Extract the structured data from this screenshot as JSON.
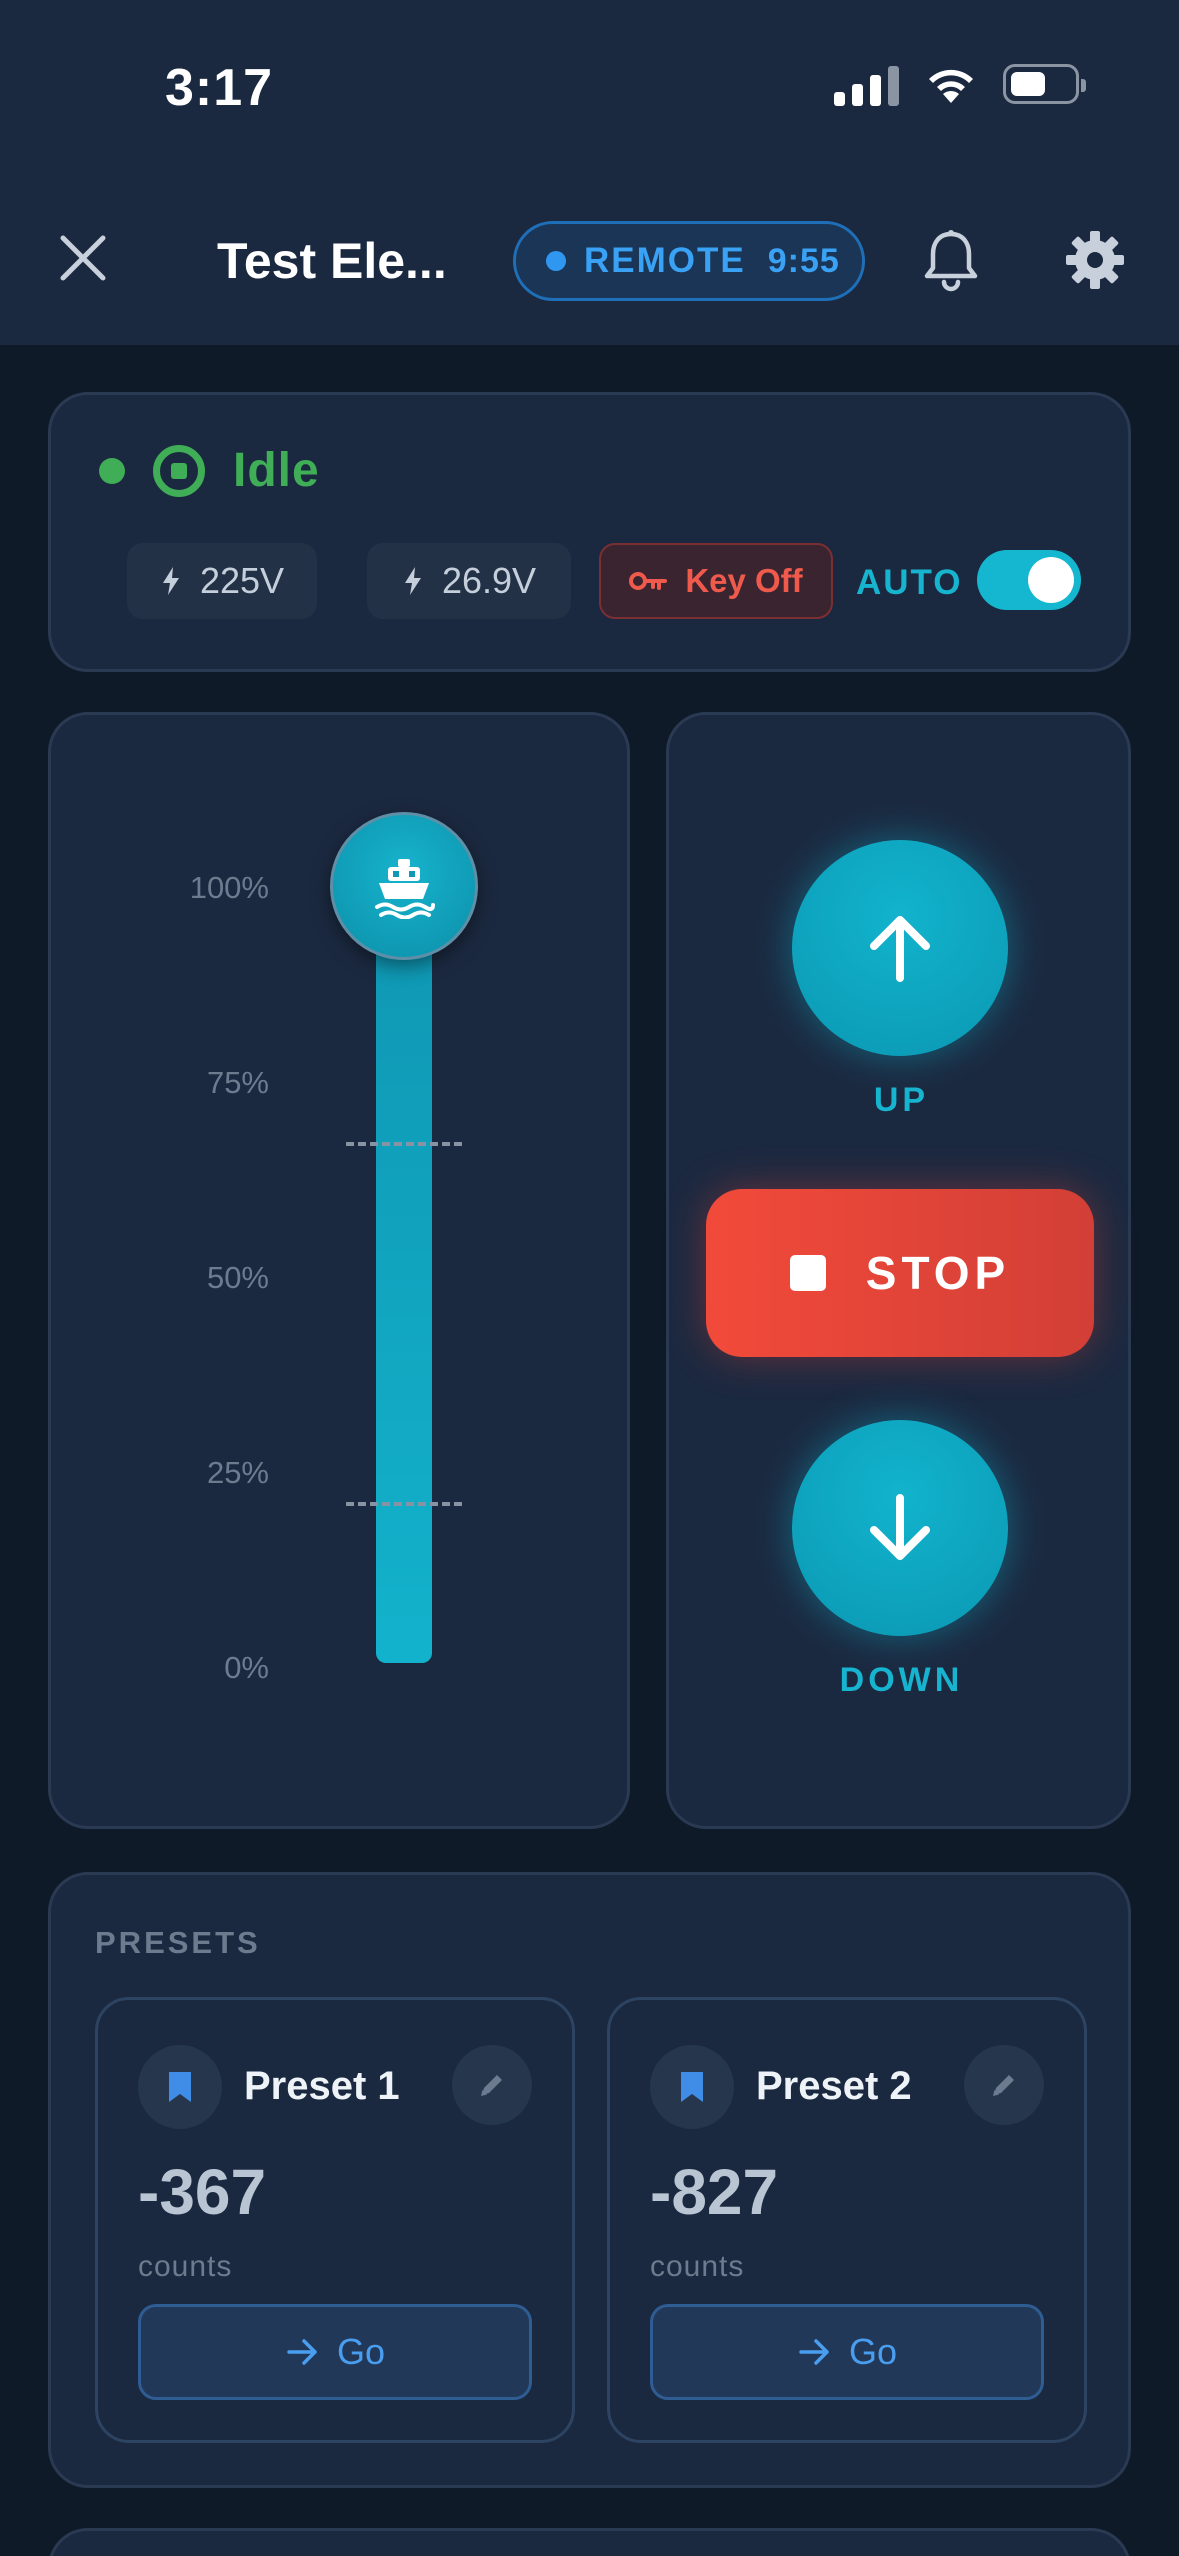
{
  "status_bar": {
    "time": "3:17"
  },
  "header": {
    "title": "Test Ele...",
    "remote": {
      "label": "REMOTE",
      "timer": "9:55"
    }
  },
  "status": {
    "state": "Idle",
    "voltage_main": "225V",
    "voltage_aux": "26.9V",
    "key": "Key Off",
    "auto_label": "AUTO",
    "auto_enabled": true
  },
  "slider": {
    "ticks": [
      "100%",
      "75%",
      "50%",
      "25%",
      "0%"
    ],
    "position_percent": 100,
    "limit_marks_percent": [
      67,
      21
    ]
  },
  "controls": {
    "up_label": "UP",
    "stop_label": "STOP",
    "down_label": "DOWN"
  },
  "presets": {
    "title": "PRESETS",
    "items": [
      {
        "name": "Preset 1",
        "value": "-367",
        "unit": "counts",
        "go": "Go"
      },
      {
        "name": "Preset 2",
        "value": "-827",
        "unit": "counts",
        "go": "Go"
      }
    ]
  },
  "colors": {
    "accent": "#17b4cf",
    "idle": "#3fae56",
    "stop": "#f24a3a",
    "remote": "#3aa2f5"
  }
}
